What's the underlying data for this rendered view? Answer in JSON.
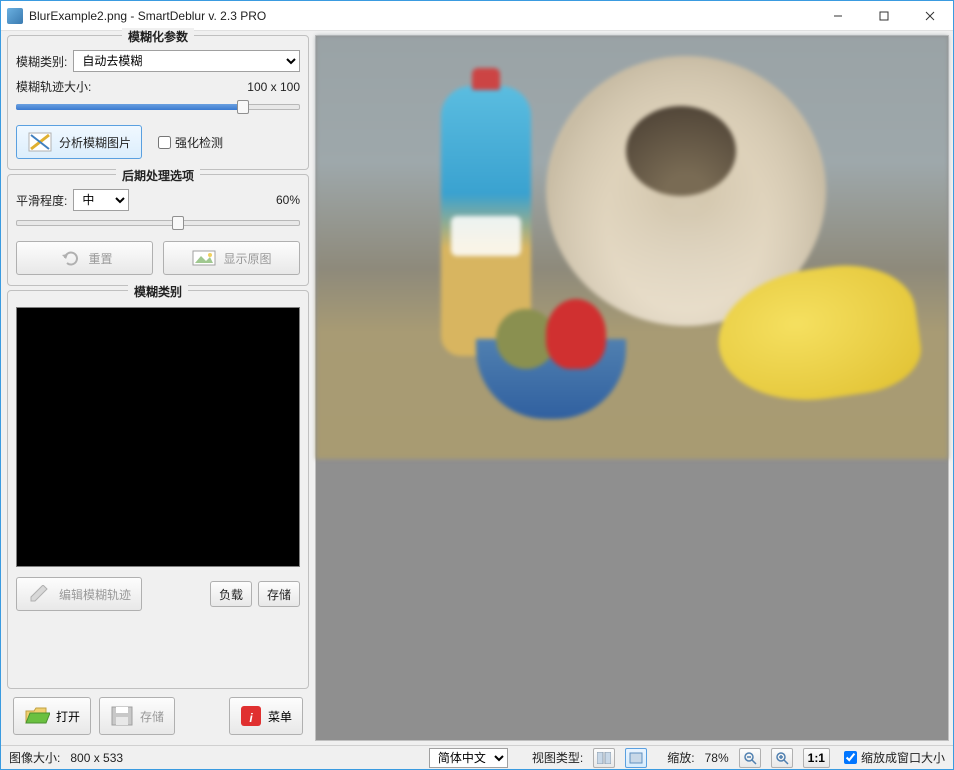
{
  "window": {
    "title": "BlurExample2.png - SmartDeblur v. 2.3 PRO"
  },
  "blur_params": {
    "legend": "模糊化参数",
    "type_label": "模糊类别:",
    "type_value": "自动去模糊",
    "size_label": "模糊轨迹大小:",
    "size_value": "100 x 100",
    "slider_percent": 80,
    "analyze_btn": "分析模糊图片",
    "aggressive_label": "强化检测",
    "aggressive_checked": false
  },
  "post_process": {
    "legend": "后期处理选项",
    "smooth_label": "平滑程度:",
    "smooth_value": "中",
    "smooth_percent_label": "60%",
    "smooth_slider_percent": 57,
    "reset_btn": "重置",
    "show_original_btn": "显示原图"
  },
  "kernel_panel": {
    "legend": "模糊类别",
    "edit_btn": "编辑模糊轨迹",
    "load_btn": "负载",
    "save_btn": "存储"
  },
  "bottom": {
    "open_btn": "打开",
    "save_btn": "存储",
    "menu_btn": "菜单"
  },
  "status": {
    "image_size_label": "图像大小:",
    "image_size_value": "800 x 533",
    "language_value": "简体中文",
    "view_type_label": "视图类型:",
    "zoom_label": "缩放:",
    "zoom_value": "78%",
    "onetoone": "1:1",
    "fit_label": "缩放成窗口大小",
    "fit_checked": true
  }
}
